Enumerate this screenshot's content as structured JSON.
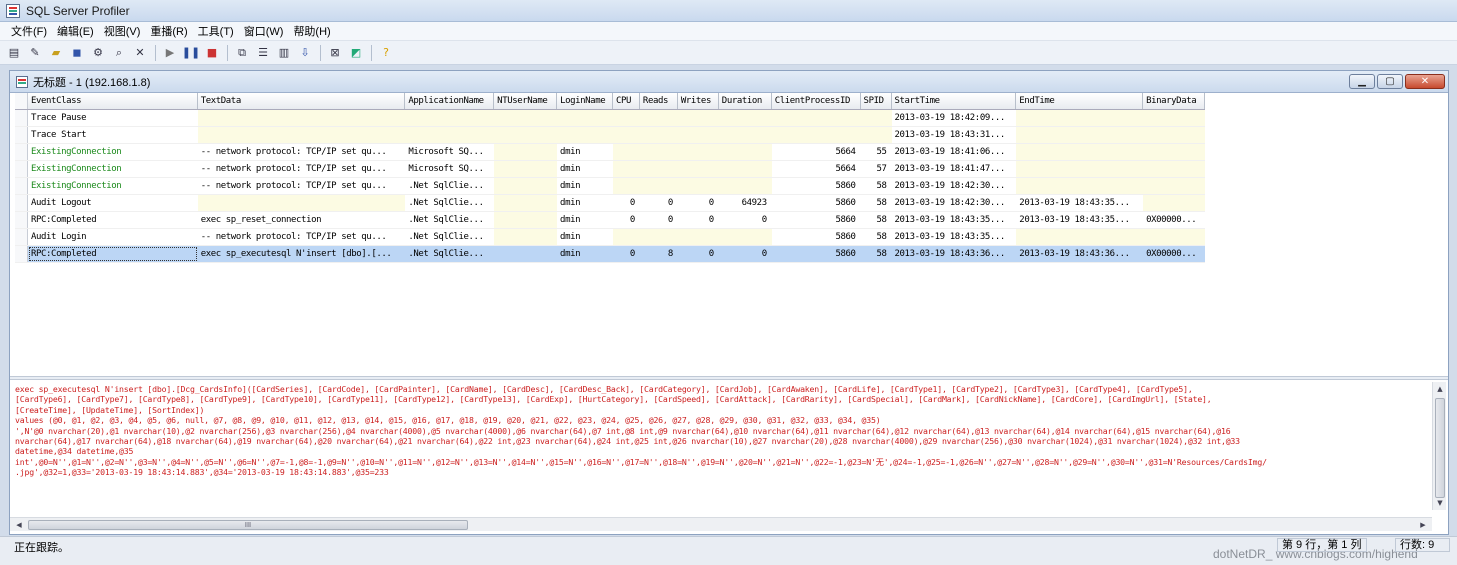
{
  "app": {
    "title": "SQL Server Profiler"
  },
  "menu": [
    "文件(F)",
    "编辑(E)",
    "视图(V)",
    "重播(R)",
    "工具(T)",
    "窗口(W)",
    "帮助(H)"
  ],
  "child_window": {
    "title": "无标题 - 1 (192.168.1.8)"
  },
  "grid": {
    "columns": [
      "EventClass",
      "TextData",
      "ApplicationName",
      "NTUserName",
      "LoginName",
      "CPU",
      "Reads",
      "Writes",
      "Duration",
      "ClientProcessID",
      "SPID",
      "StartTime",
      "EndTime",
      "BinaryData"
    ],
    "rows": [
      [
        "Trace Pause",
        "",
        "",
        "",
        "",
        "",
        "",
        "",
        "",
        "",
        "",
        "2013-03-19 18:42:09...",
        "",
        ""
      ],
      [
        "Trace Start",
        "",
        "",
        "",
        "",
        "",
        "",
        "",
        "",
        "",
        "",
        "2013-03-19 18:43:31...",
        "",
        ""
      ],
      [
        "ExistingConnection",
        "-- network protocol: TCP/IP  set qu...",
        "Microsoft SQ...",
        "",
        "dmin",
        "",
        "",
        "",
        "",
        "5664",
        "55",
        "2013-03-19 18:41:06...",
        "",
        ""
      ],
      [
        "ExistingConnection",
        "-- network protocol: TCP/IP  set qu...",
        "Microsoft SQ...",
        "",
        "dmin",
        "",
        "",
        "",
        "",
        "5664",
        "57",
        "2013-03-19 18:41:47...",
        "",
        ""
      ],
      [
        "ExistingConnection",
        "-- network protocol: TCP/IP  set qu...",
        ".Net SqlClie...",
        "",
        "dmin",
        "",
        "",
        "",
        "",
        "5860",
        "58",
        "2013-03-19 18:42:30...",
        "",
        ""
      ],
      [
        "Audit Logout",
        "",
        ".Net SqlClie...",
        "",
        "dmin",
        "0",
        "0",
        "0",
        "64923",
        "5860",
        "58",
        "2013-03-19 18:42:30...",
        "2013-03-19 18:43:35...",
        ""
      ],
      [
        "RPC:Completed",
        "exec sp_reset_connection",
        ".Net SqlClie...",
        "",
        "dmin",
        "0",
        "0",
        "0",
        "0",
        "5860",
        "58",
        "2013-03-19 18:43:35...",
        "2013-03-19 18:43:35...",
        "0X00000..."
      ],
      [
        "Audit Login",
        "-- network protocol: TCP/IP  set qu...",
        ".Net SqlClie...",
        "",
        "dmin",
        "",
        "",
        "",
        "",
        "5860",
        "58",
        "2013-03-19 18:43:35...",
        "",
        ""
      ],
      [
        "RPC:Completed",
        "exec sp_executesql N'insert [dbo].[...",
        ".Net SqlClie...",
        "",
        "dmin",
        "0",
        "8",
        "0",
        "0",
        "5860",
        "58",
        "2013-03-19 18:43:36...",
        "2013-03-19 18:43:36...",
        "0X00000..."
      ]
    ],
    "green_event": "ExistingConnection",
    "selected_row": 8
  },
  "detail": {
    "lines": [
      "exec sp_executesql N'insert [dbo].[Dcg_CardsInfo]([CardSeries], [CardCode], [CardPainter], [CardName], [CardDesc], [CardDesc_Back], [CardCategory], [CardJob], [CardAwaken], [CardLife], [CardType1], [CardType2], [CardType3], [CardType4], [CardType5],",
      "[CardType6], [CardType7], [CardType8], [CardType9], [CardType10], [CardType11], [CardType12], [CardType13], [CardExp], [HurtCategory], [CardSpeed], [CardAttack], [CardRarity], [CardSpecial], [CardMark], [CardNickName], [CardCore], [CardImgUrl], [State],",
      "[CreateTime], [UpdateTime], [SortIndex])",
      "values (@0, @1, @2, @3, @4, @5, @6, null, @7, @8, @9, @10, @11, @12, @13, @14, @15, @16, @17, @18, @19, @20, @21, @22, @23, @24, @25, @26, @27, @28, @29, @30, @31, @32, @33, @34, @35)",
      "',N'@0 nvarchar(20),@1 nvarchar(10),@2 nvarchar(256),@3 nvarchar(256),@4 nvarchar(4000),@5 nvarchar(4000),@6 nvarchar(64),@7 int,@8 int,@9 nvarchar(64),@10 nvarchar(64),@11 nvarchar(64),@12 nvarchar(64),@13 nvarchar(64),@14 nvarchar(64),@15 nvarchar(64),@16",
      "nvarchar(64),@17 nvarchar(64),@18 nvarchar(64),@19 nvarchar(64),@20 nvarchar(64),@21 nvarchar(64),@22 int,@23 nvarchar(64),@24 int,@25 int,@26 nvarchar(10),@27 nvarchar(20),@28 nvarchar(4000),@29 nvarchar(256),@30 nvarchar(1024),@31 nvarchar(1024),@32 int,@33",
      "datetime,@34 datetime,@35",
      "int',@0=N'',@1=N'',@2=N'',@3=N'',@4=N'',@5=N'',@6=N'',@7=-1,@8=-1,@9=N'',@10=N'',@11=N'',@12=N'',@13=N'',@14=N'',@15=N'',@16=N'',@17=N'',@18=N'',@19=N'',@20=N'',@21=N'',@22=-1,@23=N'无',@24=-1,@25=-1,@26=N'',@27=N'',@28=N'',@29=N'',@30=N'',@31=N'Resources/CardsImg/",
      ".jpg',@32=1,@33='2013-03-19 18:43:14.883',@34='2013-03-19 18:43:14.883',@35=233"
    ],
    "hscroll_grip": "III"
  },
  "status": {
    "text": "正在跟踪。",
    "position": "第 9 行，第 1 列",
    "rows": "行数: 9",
    "watermark": "dotNetDR_ www.cnblogs.com/highend"
  }
}
